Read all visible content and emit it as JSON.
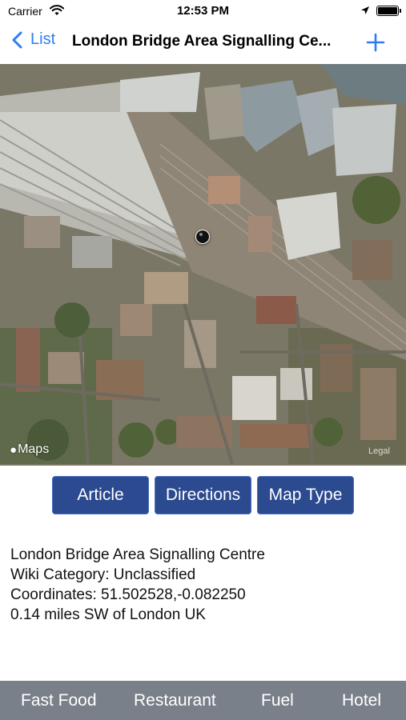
{
  "status_bar": {
    "carrier": "Carrier",
    "time": "12:53 PM",
    "icons": [
      "wifi-icon",
      "location-arrow-icon",
      "battery-icon"
    ]
  },
  "nav": {
    "back_label": "List",
    "title": "London Bridge Area Signalling Ce...",
    "back_icon": "chevron-left-icon",
    "add_icon": "plus-icon",
    "accent_color": "#2d7cf6"
  },
  "map": {
    "logo_text": "Maps",
    "legal_text": "Legal",
    "pin_icon": "map-pin-icon"
  },
  "actions": {
    "article": "Article",
    "directions": "Directions",
    "map_type": "Map Type",
    "button_color": "#2b4a8f"
  },
  "info": {
    "name": "London Bridge Area Signalling Centre",
    "category": "Wiki Category: Unclassified",
    "coordinates": "Coordinates: 51.502528,-0.082250",
    "distance": "0.14 miles SW of London UK"
  },
  "tabs": [
    {
      "label": "Fast Food"
    },
    {
      "label": "Restaurant"
    },
    {
      "label": "Fuel"
    },
    {
      "label": "Hotel"
    }
  ],
  "tab_bar_color": "#7a8089"
}
